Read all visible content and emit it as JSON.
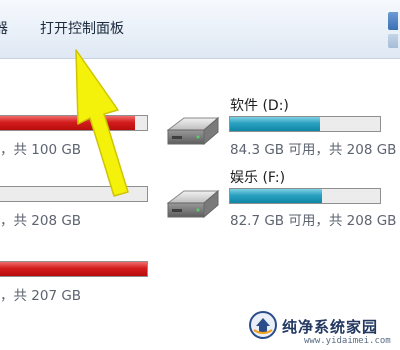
{
  "toolbar": {
    "prev_item_fragment": "器",
    "open_control_panel": "打开控制面板"
  },
  "drives_left": [
    {
      "usage_text": "，共 100 GB",
      "fill_fraction": 0.92
    },
    {
      "usage_text": "，共 208 GB",
      "fill_fraction": 0.0
    },
    {
      "usage_text": "，共 207 GB",
      "fill_fraction": 1.0
    }
  ],
  "drives_right": [
    {
      "name": "软件 (D:)",
      "usage_text": "84.3 GB 可用，共 208 GB",
      "fill_fraction": 0.6
    },
    {
      "name": "娱乐 (F:)",
      "usage_text": "82.7 GB 可用，共 208 GB",
      "fill_fraction": 0.61
    }
  ],
  "colors": {
    "bar_red": "#c91717",
    "bar_teal": "#1b93b3",
    "arrow_yellow": "#f4f20a"
  },
  "watermark": {
    "text": "纯净系统家园",
    "url": "www.yidaimei.com"
  }
}
